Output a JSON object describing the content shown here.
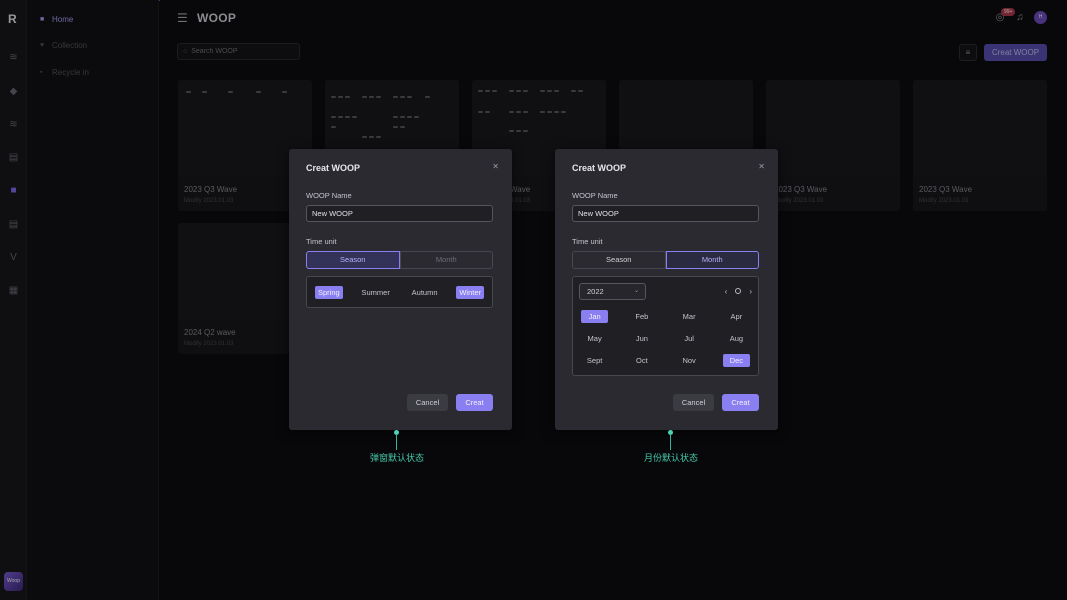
{
  "app": {
    "title": "WOOP",
    "logo_letter": "R",
    "notification_count": "99+",
    "user_initial": "H",
    "avatar_label": "Woop"
  },
  "nav": {
    "items": [
      {
        "label": "Home",
        "icon": "home-icon"
      },
      {
        "label": "Collection",
        "icon": "heart-icon"
      },
      {
        "label": "Recycle in",
        "icon": "trash-icon"
      }
    ]
  },
  "toolbar": {
    "search_placeholder": "Search WOOP",
    "create_label": "Creat WOOP"
  },
  "cards": [
    {
      "name": "2023 Q3 Wave",
      "date": "Modify 2023.01.03"
    },
    {
      "name": "",
      "date": ""
    },
    {
      "name": "Wave",
      "date": "3.01.03"
    },
    {
      "name": "",
      "date": ""
    },
    {
      "name": "2023 Q3 Wave",
      "date": "Modify 2023.01.03"
    },
    {
      "name": "2023 Q3 Wave",
      "date": "Modify 2023.01.03"
    },
    {
      "name": "2024 Q2 wave",
      "date": "Modify 2023.01.03"
    }
  ],
  "modal_season": {
    "title": "Creat WOOP",
    "name_label": "WOOP Name",
    "name_value": "New WOOP",
    "time_unit_label": "Time unit",
    "tab_season": "Season",
    "tab_month": "Month",
    "seasons": [
      "Spring",
      "Summer",
      "Autumn",
      "Winter"
    ],
    "cancel_label": "Cancel",
    "create_label": "Creat"
  },
  "modal_month": {
    "title": "Creat WOOP",
    "name_label": "WOOP Name",
    "name_value": "New WOOP",
    "time_unit_label": "Time unit",
    "tab_season": "Season",
    "tab_month": "Month",
    "year": "2022",
    "months": [
      "Jan",
      "Feb",
      "Mar",
      "Apr",
      "May",
      "Jun",
      "Jul",
      "Aug",
      "Sept",
      "Oct",
      "Nov",
      "Dec"
    ],
    "cancel_label": "Cancel",
    "create_label": "Creat"
  },
  "annotations": {
    "left": "弹窗默认状态",
    "right": "月份默认状态"
  },
  "colors": {
    "accent": "#8a7ff0",
    "annotation": "#46c9ab",
    "background": "#0d0d10"
  }
}
